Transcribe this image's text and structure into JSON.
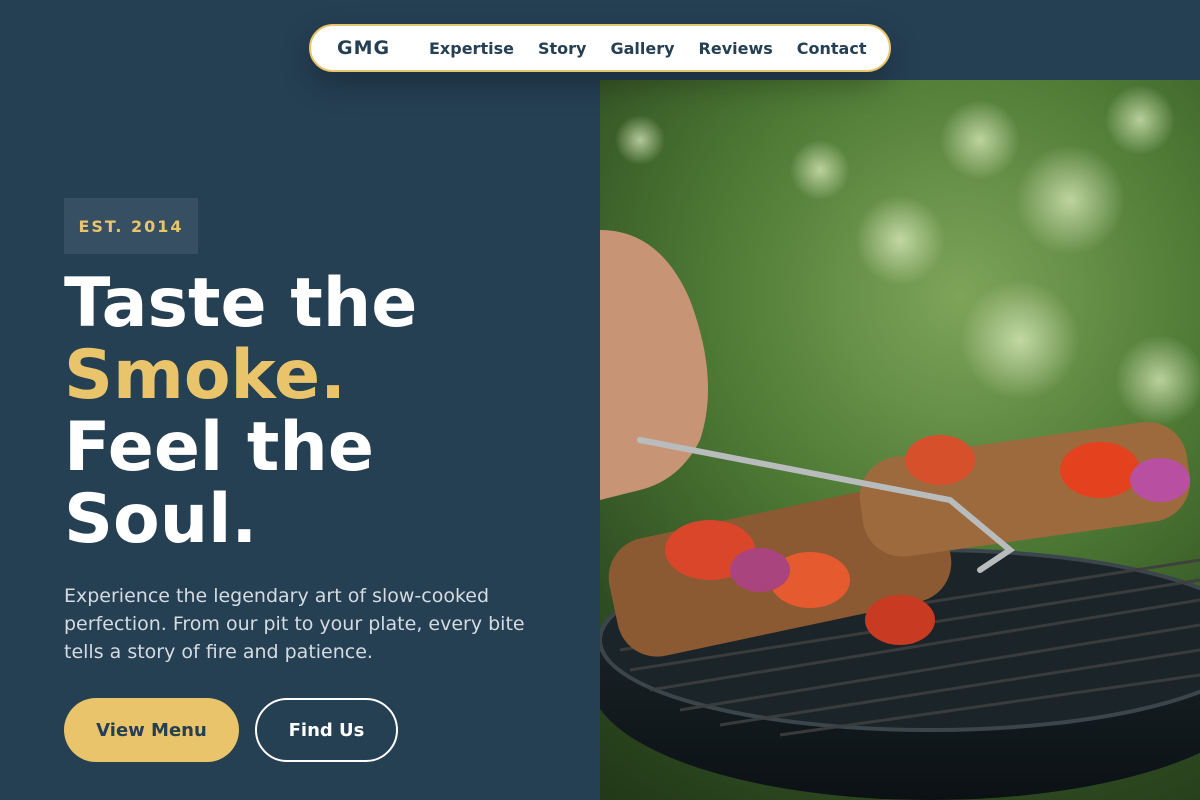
{
  "nav": {
    "brand": "GMG",
    "links": [
      "Expertise",
      "Story",
      "Gallery",
      "Reviews",
      "Contact"
    ]
  },
  "hero": {
    "badge": "EST. 2014",
    "headline_line1": "Taste the",
    "headline_accent": "Smoke.",
    "headline_line3": "Feel the",
    "headline_line4": "Soul.",
    "description": "Experience the legendary art of slow-cooked perfection. From our pit to your plate, every bite tells a story of fire and patience.",
    "primary_button": "View Menu",
    "secondary_button": "Find Us",
    "image_icon": "grill-kebab-photo"
  },
  "colors": {
    "background": "#253f53",
    "accent": "#e9c46a",
    "white": "#ffffff"
  }
}
